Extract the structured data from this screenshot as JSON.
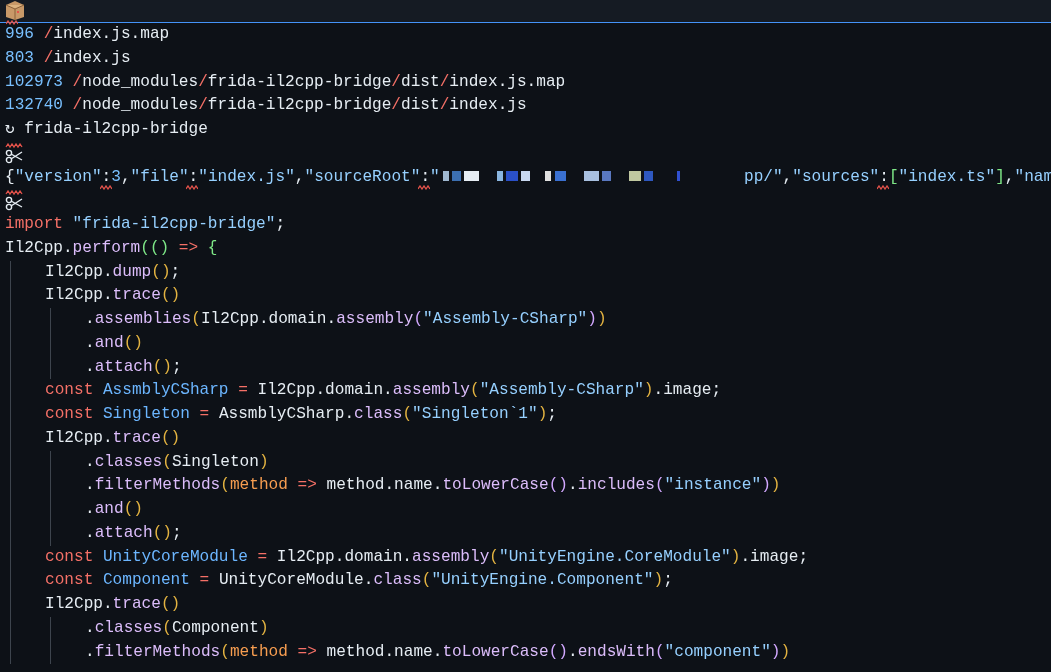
{
  "header": {
    "kind": "package"
  },
  "lines": [
    {
      "kind": "code",
      "tokens": [
        {
          "text": "996",
          "kind": "num"
        },
        {
          "text": " /",
          "kind": "slash"
        },
        {
          "text": "index.js.map",
          "kind": "plain"
        }
      ]
    },
    {
      "kind": "code",
      "tokens": [
        {
          "text": "803",
          "kind": "num"
        },
        {
          "text": " /",
          "kind": "slash"
        },
        {
          "text": "index.js",
          "kind": "plain"
        }
      ]
    },
    {
      "kind": "code",
      "tokens": [
        {
          "text": "102973",
          "kind": "num"
        },
        {
          "text": " /",
          "kind": "slash"
        },
        {
          "text": "node_modules",
          "kind": "plain"
        },
        {
          "text": "/",
          "kind": "slash"
        },
        {
          "text": "frida-il2cpp-bridge",
          "kind": "plain"
        },
        {
          "text": "/",
          "kind": "slash"
        },
        {
          "text": "dist",
          "kind": "plain"
        },
        {
          "text": "/",
          "kind": "slash"
        },
        {
          "text": "index.js.map",
          "kind": "plain"
        }
      ]
    },
    {
      "kind": "code",
      "tokens": [
        {
          "text": "132740",
          "kind": "num"
        },
        {
          "text": " /",
          "kind": "slash"
        },
        {
          "text": "node_modules",
          "kind": "plain"
        },
        {
          "text": "/",
          "kind": "slash"
        },
        {
          "text": "frida-il2cpp-bridge",
          "kind": "plain"
        },
        {
          "text": "/",
          "kind": "slash"
        },
        {
          "text": "dist",
          "kind": "plain"
        },
        {
          "text": "/",
          "kind": "slash"
        },
        {
          "text": "index.js",
          "kind": "plain"
        }
      ]
    },
    {
      "kind": "code",
      "tokens": [
        {
          "text": "↻ frida-il2cpp-bridge",
          "kind": "plain"
        }
      ]
    },
    {
      "kind": "cut"
    },
    {
      "kind": "code",
      "tokens": [
        {
          "text": "{",
          "kind": "plain"
        },
        {
          "text": "\"version\"",
          "kind": "str"
        },
        {
          "text": ":",
          "kind": "flagged"
        },
        {
          "text": "3",
          "kind": "num"
        },
        {
          "text": ",",
          "kind": "plain"
        },
        {
          "text": "\"file\"",
          "kind": "str"
        },
        {
          "text": ":",
          "kind": "flagged"
        },
        {
          "text": "\"index.js\"",
          "kind": "str"
        },
        {
          "text": ",",
          "kind": "plain"
        },
        {
          "text": "\"sourceRoot\"",
          "kind": "str"
        },
        {
          "text": ":",
          "kind": "flagged"
        },
        {
          "text": "\"",
          "kind": "str"
        },
        {
          "kind": "redacted"
        },
        {
          "text": "pp/\"",
          "kind": "str"
        },
        {
          "text": ",",
          "kind": "plain"
        },
        {
          "text": "\"sources\"",
          "kind": "str"
        },
        {
          "text": ":",
          "kind": "flagged"
        },
        {
          "text": "[",
          "kind": "bg"
        },
        {
          "text": "\"index.ts\"",
          "kind": "str"
        },
        {
          "text": "]",
          "kind": "bg"
        },
        {
          "text": ",",
          "kind": "plain"
        },
        {
          "text": "\"nam",
          "kind": "str"
        }
      ]
    },
    {
      "kind": "cut"
    },
    {
      "kind": "code",
      "tokens": [
        {
          "text": "import",
          "kind": "kw"
        },
        {
          "text": " \"frida-il2cpp-bridge\"",
          "kind": "str"
        },
        {
          "text": ";",
          "kind": "plain"
        }
      ]
    },
    {
      "kind": "code",
      "tokens": [
        {
          "text": "Il2Cpp.",
          "kind": "plain"
        },
        {
          "text": "perform",
          "kind": "fn"
        },
        {
          "text": "(()",
          "kind": "bg"
        },
        {
          "text": " =>",
          "kind": "op"
        },
        {
          "text": " {",
          "kind": "bg"
        }
      ],
      "children": [
        {
          "kind": "code",
          "tokens": [
            {
              "text": "Il2Cpp.",
              "kind": "plain"
            },
            {
              "text": "dump",
              "kind": "fn"
            },
            {
              "text": "()",
              "kind": "by"
            },
            {
              "text": ";",
              "kind": "plain"
            }
          ]
        },
        {
          "kind": "code",
          "tokens": [
            {
              "text": "Il2Cpp.",
              "kind": "plain"
            },
            {
              "text": "trace",
              "kind": "fn"
            },
            {
              "text": "()",
              "kind": "by"
            }
          ],
          "children": [
            {
              "kind": "code",
              "tokens": [
                {
                  "text": ".",
                  "kind": "plain"
                },
                {
                  "text": "assemblies",
                  "kind": "fn"
                },
                {
                  "text": "(",
                  "kind": "by"
                },
                {
                  "text": "Il2Cpp.domain.",
                  "kind": "plain"
                },
                {
                  "text": "assembly",
                  "kind": "fn"
                },
                {
                  "text": "(",
                  "kind": "bp"
                },
                {
                  "text": "\"Assembly-CSharp\"",
                  "kind": "str"
                },
                {
                  "text": ")",
                  "kind": "bp"
                },
                {
                  "text": ")",
                  "kind": "by"
                }
              ]
            },
            {
              "kind": "code",
              "tokens": [
                {
                  "text": ".",
                  "kind": "plain"
                },
                {
                  "text": "and",
                  "kind": "fn"
                },
                {
                  "text": "()",
                  "kind": "by"
                }
              ]
            },
            {
              "kind": "code",
              "tokens": [
                {
                  "text": ".",
                  "kind": "plain"
                },
                {
                  "text": "attach",
                  "kind": "fn"
                },
                {
                  "text": "()",
                  "kind": "by"
                },
                {
                  "text": ";",
                  "kind": "plain"
                }
              ]
            }
          ]
        },
        {
          "kind": "code",
          "tokens": [
            {
              "text": "const",
              "kind": "kw"
            },
            {
              "text": " AssmblyCSharp",
              "kind": "var"
            },
            {
              "text": " =",
              "kind": "op"
            },
            {
              "text": " Il2Cpp.domain.",
              "kind": "plain"
            },
            {
              "text": "assembly",
              "kind": "fn"
            },
            {
              "text": "(",
              "kind": "by"
            },
            {
              "text": "\"Assembly-CSharp\"",
              "kind": "str"
            },
            {
              "text": ")",
              "kind": "by"
            },
            {
              "text": ".image;",
              "kind": "plain"
            }
          ]
        },
        {
          "kind": "code",
          "tokens": [
            {
              "text": "const",
              "kind": "kw"
            },
            {
              "text": " Singleton",
              "kind": "var"
            },
            {
              "text": " =",
              "kind": "op"
            },
            {
              "text": " AssmblyCSharp.",
              "kind": "plain"
            },
            {
              "text": "class",
              "kind": "fn"
            },
            {
              "text": "(",
              "kind": "by"
            },
            {
              "text": "\"Singleton`1\"",
              "kind": "str"
            },
            {
              "text": ")",
              "kind": "by"
            },
            {
              "text": ";",
              "kind": "plain"
            }
          ]
        },
        {
          "kind": "code",
          "tokens": [
            {
              "text": "Il2Cpp.",
              "kind": "plain"
            },
            {
              "text": "trace",
              "kind": "fn"
            },
            {
              "text": "()",
              "kind": "by"
            }
          ],
          "children": [
            {
              "kind": "code",
              "tokens": [
                {
                  "text": ".",
                  "kind": "plain"
                },
                {
                  "text": "classes",
                  "kind": "fn"
                },
                {
                  "text": "(",
                  "kind": "by"
                },
                {
                  "text": "Singleton",
                  "kind": "plain"
                },
                {
                  "text": ")",
                  "kind": "by"
                }
              ]
            },
            {
              "kind": "code",
              "tokens": [
                {
                  "text": ".",
                  "kind": "plain"
                },
                {
                  "text": "filterMethods",
                  "kind": "fn"
                },
                {
                  "text": "(",
                  "kind": "by"
                },
                {
                  "text": "method",
                  "kind": "param"
                },
                {
                  "text": " =>",
                  "kind": "op"
                },
                {
                  "text": " method.name.",
                  "kind": "plain"
                },
                {
                  "text": "toLowerCase",
                  "kind": "fn"
                },
                {
                  "text": "()",
                  "kind": "bp"
                },
                {
                  "text": ".",
                  "kind": "plain"
                },
                {
                  "text": "includes",
                  "kind": "fn"
                },
                {
                  "text": "(",
                  "kind": "bp"
                },
                {
                  "text": "\"instance\"",
                  "kind": "str"
                },
                {
                  "text": ")",
                  "kind": "bp"
                },
                {
                  "text": ")",
                  "kind": "by"
                }
              ]
            },
            {
              "kind": "code",
              "tokens": [
                {
                  "text": ".",
                  "kind": "plain"
                },
                {
                  "text": "and",
                  "kind": "fn"
                },
                {
                  "text": "()",
                  "kind": "by"
                }
              ]
            },
            {
              "kind": "code",
              "tokens": [
                {
                  "text": ".",
                  "kind": "plain"
                },
                {
                  "text": "attach",
                  "kind": "fn"
                },
                {
                  "text": "()",
                  "kind": "by"
                },
                {
                  "text": ";",
                  "kind": "plain"
                }
              ]
            }
          ]
        },
        {
          "kind": "code",
          "tokens": [
            {
              "text": "const",
              "kind": "kw"
            },
            {
              "text": " UnityCoreModule",
              "kind": "var"
            },
            {
              "text": " =",
              "kind": "op"
            },
            {
              "text": " Il2Cpp.domain.",
              "kind": "plain"
            },
            {
              "text": "assembly",
              "kind": "fn"
            },
            {
              "text": "(",
              "kind": "by"
            },
            {
              "text": "\"UnityEngine.CoreModule\"",
              "kind": "str"
            },
            {
              "text": ")",
              "kind": "by"
            },
            {
              "text": ".image;",
              "kind": "plain"
            }
          ]
        },
        {
          "kind": "code",
          "tokens": [
            {
              "text": "const",
              "kind": "kw"
            },
            {
              "text": " Component",
              "kind": "var"
            },
            {
              "text": " =",
              "kind": "op"
            },
            {
              "text": " UnityCoreModule.",
              "kind": "plain"
            },
            {
              "text": "class",
              "kind": "fn"
            },
            {
              "text": "(",
              "kind": "by"
            },
            {
              "text": "\"UnityEngine.Component\"",
              "kind": "str"
            },
            {
              "text": ")",
              "kind": "by"
            },
            {
              "text": ";",
              "kind": "plain"
            }
          ]
        },
        {
          "kind": "code",
          "tokens": [
            {
              "text": "Il2Cpp.",
              "kind": "plain"
            },
            {
              "text": "trace",
              "kind": "fn"
            },
            {
              "text": "()",
              "kind": "by"
            }
          ],
          "children": [
            {
              "kind": "code",
              "tokens": [
                {
                  "text": ".",
                  "kind": "plain"
                },
                {
                  "text": "classes",
                  "kind": "fn"
                },
                {
                  "text": "(",
                  "kind": "by"
                },
                {
                  "text": "Component",
                  "kind": "plain"
                },
                {
                  "text": ")",
                  "kind": "by"
                }
              ]
            },
            {
              "kind": "code",
              "tokens": [
                {
                  "text": ".",
                  "kind": "plain"
                },
                {
                  "text": "filterMethods",
                  "kind": "fn"
                },
                {
                  "text": "(",
                  "kind": "by"
                },
                {
                  "text": "method",
                  "kind": "param"
                },
                {
                  "text": " =>",
                  "kind": "op"
                },
                {
                  "text": " method.name.",
                  "kind": "plain"
                },
                {
                  "text": "toLowerCase",
                  "kind": "fn"
                },
                {
                  "text": "()",
                  "kind": "bp"
                },
                {
                  "text": ".",
                  "kind": "plain"
                },
                {
                  "text": "endsWith",
                  "kind": "fn"
                },
                {
                  "text": "(",
                  "kind": "bp"
                },
                {
                  "text": "\"component\"",
                  "kind": "str"
                },
                {
                  "text": ")",
                  "kind": "bp"
                },
                {
                  "text": ")",
                  "kind": "by"
                }
              ]
            }
          ]
        }
      ]
    }
  ]
}
